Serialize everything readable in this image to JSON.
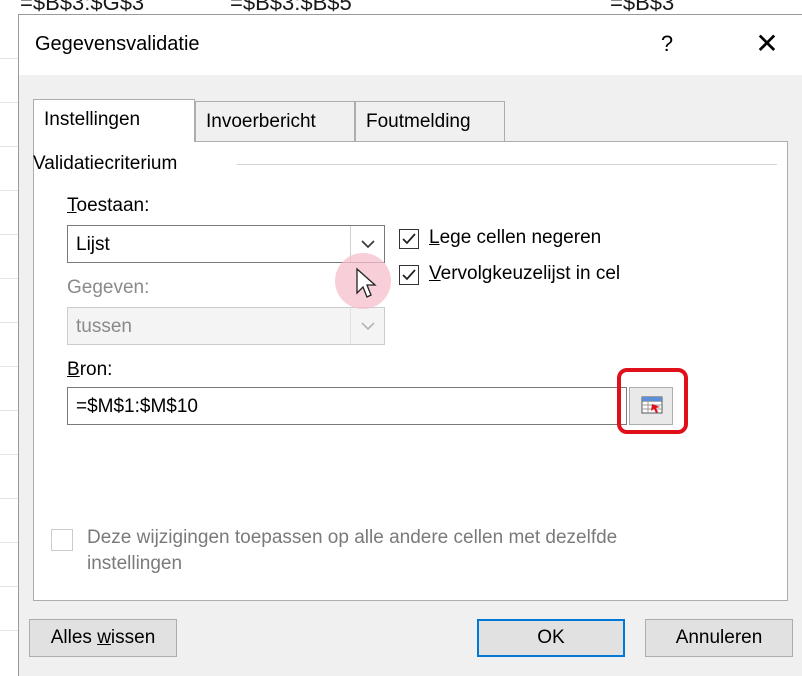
{
  "window": {
    "title": "Gegevensvalidatie",
    "help_label": "?",
    "close_label": "✕"
  },
  "background": {
    "cell_fragments": [
      "=$B$3:$G$3",
      "=$B$3:$B$5",
      "=$B$3"
    ]
  },
  "tabs": [
    {
      "label": "Instellingen",
      "active": true
    },
    {
      "label": "Invoerbericht",
      "active": false
    },
    {
      "label": "Foutmelding",
      "active": false
    }
  ],
  "criteria": {
    "group_label": "Validatiecriterium",
    "allow_label": "Toestaan:",
    "allow_value": "Lijst",
    "data_label": "Gegeven:",
    "data_value": "tussen",
    "ignore_blank_label": "Lege cellen negeren",
    "ignore_blank_checked": true,
    "in_cell_dropdown_label": "Vervolgkeuzelijst in cel",
    "in_cell_dropdown_checked": true,
    "source_label": "Bron:",
    "source_value": "=$M$1:$M$10"
  },
  "apply_all": {
    "label_line1": "Deze wijzigingen toepassen op alle andere cellen met dezelfde",
    "label_line2": "instellingen",
    "checked": false
  },
  "buttons": {
    "clear_all": "Alles wissen",
    "ok": "OK",
    "cancel": "Annuleren"
  },
  "colors": {
    "highlight": "#e0101a",
    "default_button_border": "#0078d7",
    "cursor_halo": "#f6becc"
  }
}
